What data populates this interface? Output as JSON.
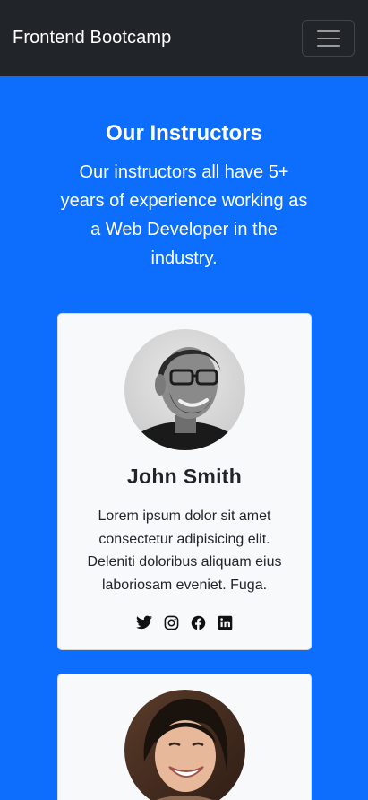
{
  "navbar": {
    "brand": "Frontend Bootcamp",
    "toggle_icon": "hamburger-menu-icon"
  },
  "instructors": {
    "heading": "Our Instructors",
    "lead": "Our instructors all have 5+ years of experience working as a Web Developer in the industry.",
    "cards": [
      {
        "name": "John Smith",
        "bio": "Lorem ipsum dolor sit amet consectetur adipisicing elit. Deleniti doloribus aliquam eius laboriosam eveniet. Fuga.",
        "socials": [
          "twitter-icon",
          "instagram-icon",
          "facebook-icon",
          "linkedin-icon"
        ]
      },
      {
        "name": "",
        "bio": ""
      }
    ]
  },
  "colors": {
    "navbar_bg": "#212529",
    "section_bg": "#0d6efd",
    "card_bg": "#f8f9fa",
    "text_dark": "#212529"
  }
}
